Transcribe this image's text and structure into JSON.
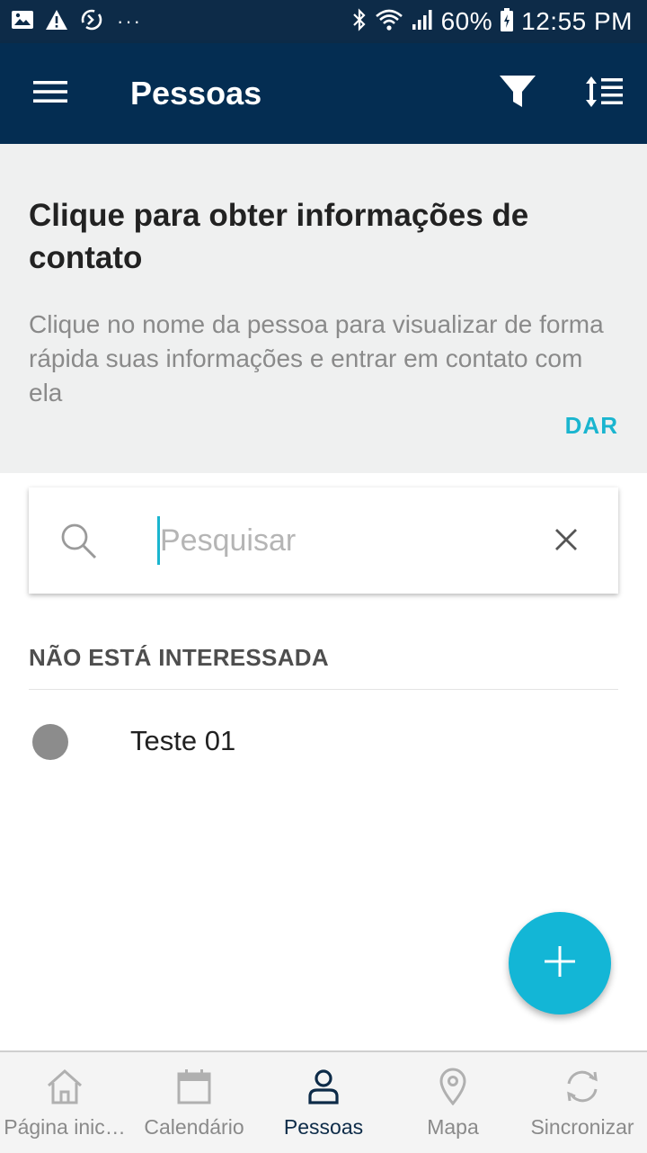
{
  "status_bar": {
    "battery": "60%",
    "time": "12:55 PM",
    "dots": "···",
    "icons": [
      "image-icon",
      "warning-icon",
      "sync-icon",
      "bluetooth-icon",
      "wifi-icon",
      "signal-icon",
      "battery-icon"
    ]
  },
  "app_bar": {
    "title": "Pessoas",
    "icons": [
      "menu-icon",
      "filter-icon",
      "sort-icon"
    ]
  },
  "tip": {
    "title": "Clique para obter informações de contato",
    "body": "Clique no nome da pessoa para visualizar de forma rápida suas informações e entrar em contato com ela",
    "action": "DAR"
  },
  "search": {
    "placeholder": "Pesquisar",
    "value": ""
  },
  "section": {
    "header": "NÃO ESTÁ INTERESSADA",
    "items": [
      {
        "label": "Teste 01",
        "status_color": "#8c8c8c"
      }
    ]
  },
  "colors": {
    "primary": "#042d52",
    "status_bar": "#0d2b48",
    "accent": "#13b6d6",
    "tip_background": "#eff0f0"
  },
  "bottom_nav": {
    "items": [
      {
        "label": "Página inic…",
        "icon": "home-icon",
        "active": false
      },
      {
        "label": "Calendário",
        "icon": "calendar-icon",
        "active": false
      },
      {
        "label": "Pessoas",
        "icon": "person-icon",
        "active": true
      },
      {
        "label": "Mapa",
        "icon": "map-pin-icon",
        "active": false
      },
      {
        "label": "Sincronizar",
        "icon": "sync-icon",
        "active": false
      }
    ]
  }
}
